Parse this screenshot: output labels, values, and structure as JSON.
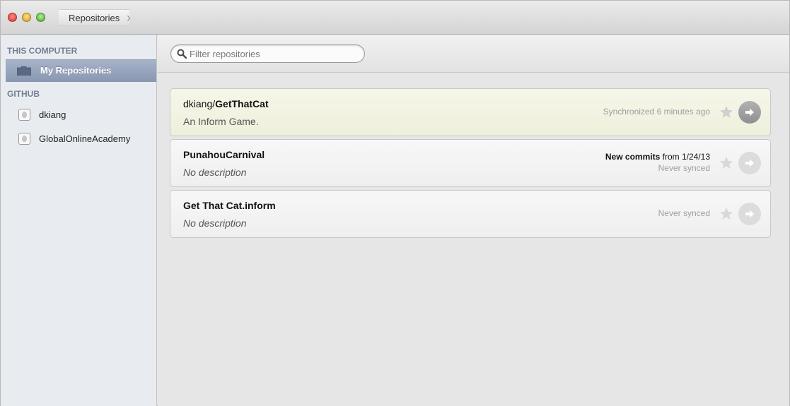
{
  "window": {
    "breadcrumb": "Repositories"
  },
  "sidebar": {
    "this_computer_header": "THIS COMPUTER",
    "my_repositories_label": "My Repositories",
    "github_header": "GITHUB",
    "orgs": [
      "dkiang",
      "GlobalOnlineAcademy"
    ]
  },
  "filter": {
    "placeholder": "Filter repositories",
    "value": ""
  },
  "repos": [
    {
      "owner": "dkiang/",
      "name": "GetThatCat",
      "description": "An Inform Game.",
      "status": "Synchronized 6 minutes ago",
      "starred": false,
      "highlight": true
    },
    {
      "owner": "",
      "name": "PunahouCarnival",
      "description": "No description",
      "status_bold": "New commits",
      "status_rest": " from 1/24/13",
      "status": "Never synced",
      "starred": false,
      "highlight": false
    },
    {
      "owner": "",
      "name": "Get That Cat.inform",
      "description": "No description",
      "status": "Never synced",
      "starred": false,
      "highlight": false
    }
  ],
  "colors": {
    "sidebar_selected": "#8f9db5",
    "sidebar_header": "#6f7e91",
    "highlight_row": "#f1f2e1",
    "status_text": "#9e9e9e"
  }
}
